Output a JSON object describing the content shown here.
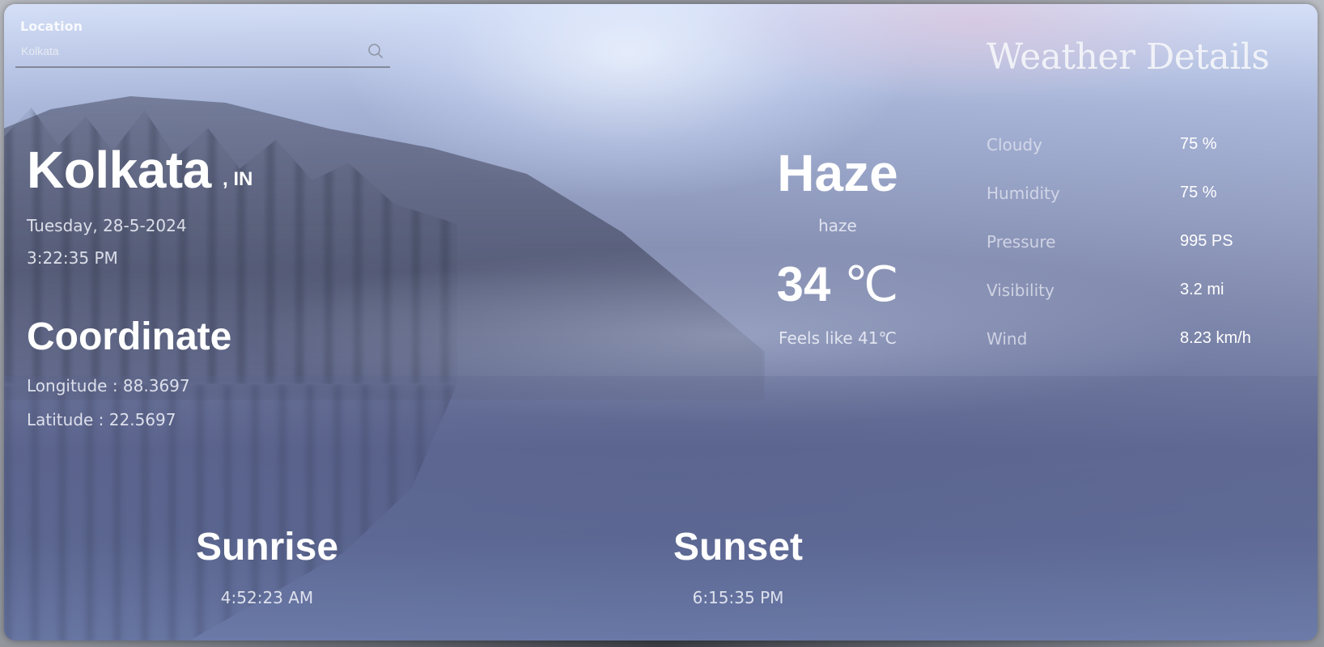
{
  "search": {
    "label": "Location",
    "value": "Kolkata",
    "placeholder": "Kolkata"
  },
  "location": {
    "city": "Kolkata",
    "country": ", IN",
    "date": "Tuesday, 28-5-2024",
    "time": "3:22:35 PM"
  },
  "coordinate": {
    "title": "Coordinate",
    "longitude": "Longitude : 88.3697",
    "latitude": "Latitude : 22.5697"
  },
  "weather": {
    "condition": "Haze",
    "description": "haze",
    "temp_value": "34 ",
    "temp_unit": "℃",
    "feels_like": "Feels like 41℃"
  },
  "details": {
    "title": "Weather Details",
    "rows": [
      {
        "label": "Cloudy",
        "value": "75 %"
      },
      {
        "label": "Humidity",
        "value": "75 %"
      },
      {
        "label": "Pressure",
        "value": "995 PS"
      },
      {
        "label": "Visibility",
        "value": "3.2 mi"
      },
      {
        "label": "Wind",
        "value": "8.23 km/h"
      }
    ]
  },
  "sun": {
    "sunrise_label": "Sunrise",
    "sunrise_time": "4:52:23 AM",
    "sunset_label": "Sunset",
    "sunset_time": "6:15:35 PM"
  },
  "icons": {
    "search": "search-icon"
  }
}
